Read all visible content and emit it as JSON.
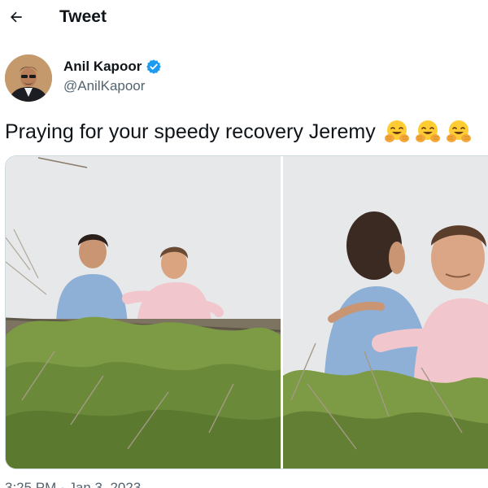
{
  "header": {
    "title": "Tweet"
  },
  "author": {
    "name": "Anil Kapoor",
    "handle": "@AnilKapoor",
    "verified": true
  },
  "tweet": {
    "text": "Praying for your speedy recovery Jeremy",
    "emoji_icon": "hugging-face-emoji",
    "emoji_count": 3,
    "timestamp": "3:25 PM · Jan 3, 2023"
  },
  "colors": {
    "verified_badge": "#1d9bf0",
    "secondary_text": "#536471",
    "border": "#cfd9de"
  }
}
